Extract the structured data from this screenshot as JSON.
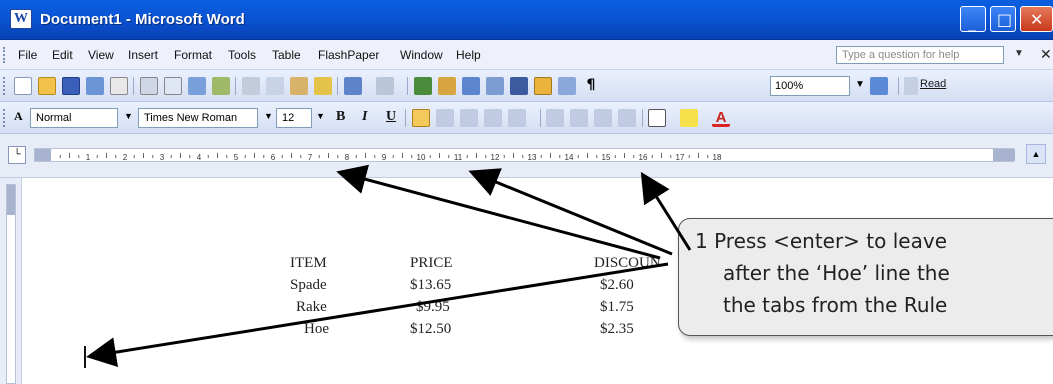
{
  "window": {
    "title": "Document1 - Microsoft Word"
  },
  "menu": {
    "items": [
      "File",
      "Edit",
      "View",
      "Insert",
      "Format",
      "Tools",
      "Table",
      "FlashPaper",
      "Window",
      "Help"
    ],
    "ask_placeholder": "Type a question for help"
  },
  "standard_toolbar": {
    "zoom": "100%",
    "read_label": "Read"
  },
  "formatting_toolbar": {
    "style": "Normal",
    "font": "Times New Roman",
    "size": "12",
    "bold": "B",
    "italic": "I",
    "underline": "U"
  },
  "ruler": {
    "labels": [
      "1",
      "2",
      "3",
      "4",
      "5",
      "6",
      "7",
      "8",
      "9",
      "10",
      "11",
      "12",
      "13",
      "14",
      "15",
      "16",
      "17",
      "18"
    ]
  },
  "table": {
    "headers": [
      "ITEM",
      "PRICE",
      "DISCOUN"
    ],
    "rows": [
      [
        "Spade",
        "$13.65",
        "$2.60"
      ],
      [
        "Rake",
        "$9.95",
        "$1.75"
      ],
      [
        "Hoe",
        "$12.50",
        "$2.35"
      ]
    ]
  },
  "callout": {
    "lines": [
      "1  Press <enter> to leave",
      "after the ‘Hoe’ line the",
      "the tabs from the Rule"
    ]
  },
  "colors": {
    "title_bar": "#0b54d6",
    "callout_bg": "#ececec",
    "close_button": "#d44a2c"
  }
}
